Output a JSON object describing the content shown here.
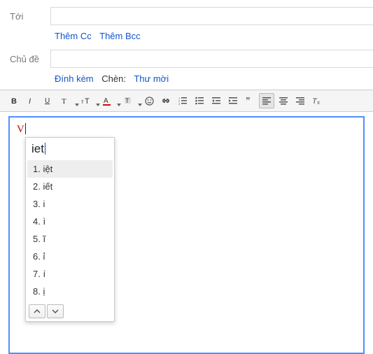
{
  "form": {
    "to_label": "Tới",
    "subject_label": "Chủ đề",
    "to_value": "",
    "subject_value": ""
  },
  "links": {
    "add_cc": "Thêm Cc",
    "add_bcc": "Thêm Bcc",
    "attach": "Đính kèm",
    "insert_label": "Chèn:",
    "invitation": "Thư mời"
  },
  "compose": {
    "typed": "V"
  },
  "ime": {
    "buffer": "iet",
    "candidates": [
      "1. iệt",
      "2. iết",
      "3. i",
      "4. ì",
      "5. ĩ",
      "6. ỉ",
      "7. í",
      "8. ị"
    ],
    "selected_index": 0
  }
}
